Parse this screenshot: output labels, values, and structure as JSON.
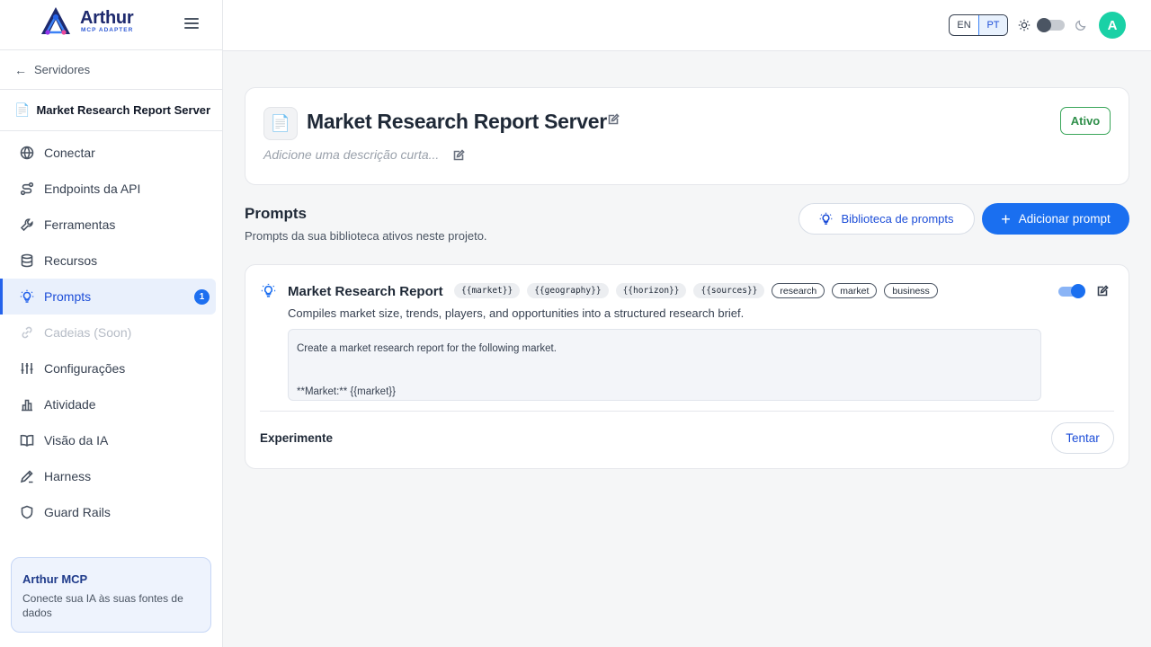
{
  "brand": {
    "name": "Arthur",
    "sub": "MCP ADAPTER"
  },
  "back": {
    "label": "Servidores"
  },
  "server": {
    "name": "Market Research Report Server"
  },
  "nav": [
    {
      "label": "Conectar",
      "icon": "globe-icon"
    },
    {
      "label": "Endpoints da API",
      "icon": "route-icon"
    },
    {
      "label": "Ferramentas",
      "icon": "wrench-icon"
    },
    {
      "label": "Recursos",
      "icon": "database-icon"
    },
    {
      "label": "Prompts",
      "icon": "lightbulb-icon",
      "active": true,
      "badge": "1"
    },
    {
      "label": "Cadeias (Soon)",
      "icon": "link-icon",
      "disabled": true
    },
    {
      "label": "Configurações",
      "icon": "sliders-icon"
    },
    {
      "label": "Atividade",
      "icon": "bar-chart-icon"
    },
    {
      "label": "Visão da IA",
      "icon": "book-icon"
    },
    {
      "label": "Harness",
      "icon": "pen-ruler-icon"
    },
    {
      "label": "Guard Rails",
      "icon": "shield-icon"
    }
  ],
  "promo": {
    "title": "Arthur MCP",
    "text": "Conecte sua IA às suas fontes de dados"
  },
  "topbar": {
    "lang_en": "EN",
    "lang_pt": "PT",
    "avatar": "A"
  },
  "header": {
    "title": "Market Research Report Server",
    "description_placeholder": "Adicione uma descrição curta...",
    "status": "Ativo",
    "status_color": "#2f8f4a"
  },
  "section": {
    "title": "Prompts",
    "subtitle": "Prompts da sua biblioteca ativos neste projeto.",
    "library_button": "Biblioteca de prompts",
    "add_button": "Adicionar prompt"
  },
  "prompt": {
    "name": "Market Research Report",
    "variables": [
      "{{market}}",
      "{{geography}}",
      "{{horizon}}",
      "{{sources}}"
    ],
    "tags": [
      "research",
      "market",
      "business"
    ],
    "description": "Compiles market size, trends, players, and opportunities into a structured research brief.",
    "body_line1": "Create a market research report for the following market.",
    "body_line2": "**Market:** {{market}}",
    "enabled": true,
    "try_label": "Experimente",
    "try_button": "Tentar"
  },
  "colors": {
    "accent": "#1a6ff0",
    "avatar": "#1ad1a6",
    "active_bg": "#e9f0fc"
  }
}
